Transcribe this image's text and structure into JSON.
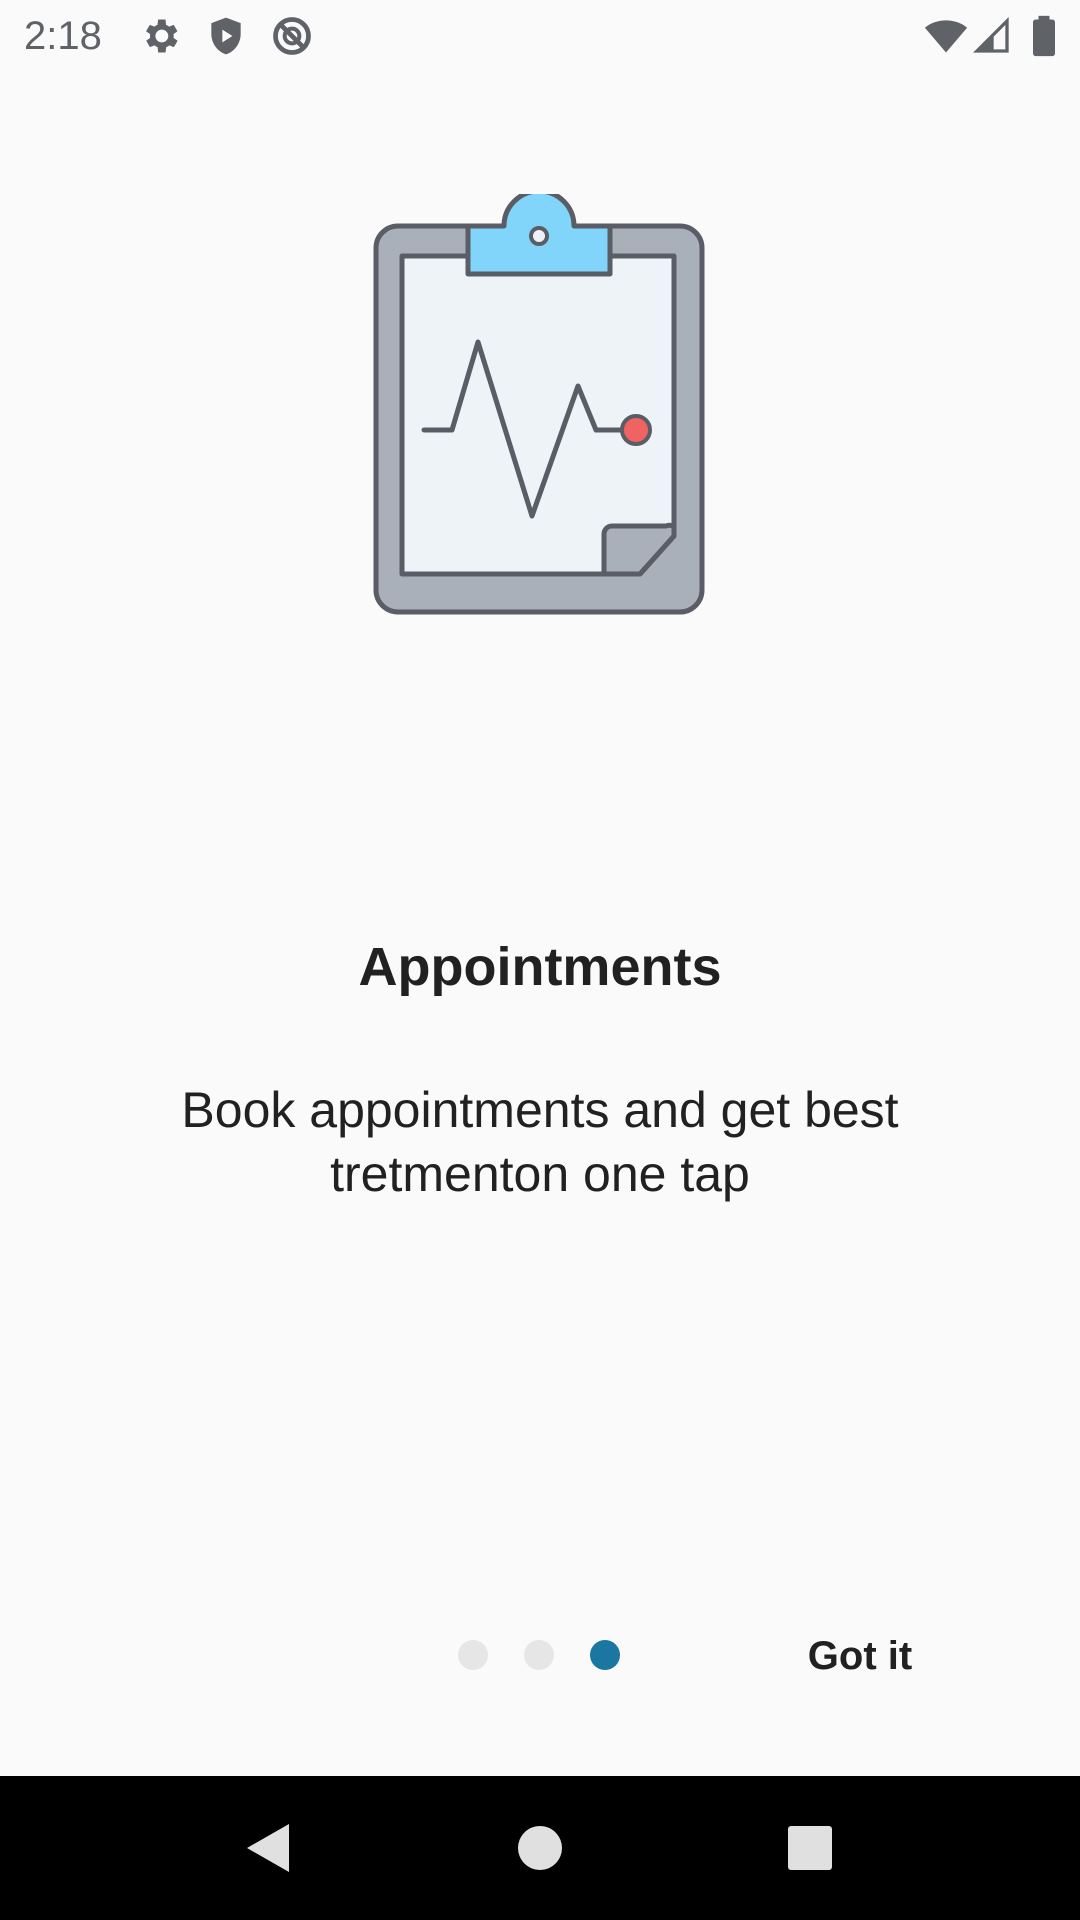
{
  "status_bar": {
    "time": "2:18",
    "left_icons": [
      "gear-icon",
      "shield-play-icon",
      "do-not-disturb-icon"
    ],
    "right_icons": [
      "wifi-icon",
      "cell-signal-icon",
      "battery-icon"
    ]
  },
  "onboarding": {
    "illustration_icon": "clipboard-heartbeat-icon",
    "title": "Appointments",
    "description": "Book appointments and get best tretmenton one tap",
    "page_indicator": {
      "total": 3,
      "active_index": 2
    },
    "got_it_label": "Got it"
  },
  "nav_bar": {
    "buttons": [
      "back-icon",
      "home-icon",
      "recents-icon"
    ]
  },
  "colors": {
    "background": "#fafafa",
    "accent": "#1c76a2",
    "inactive_dot": "#e6e6e6",
    "clip_blue": "#81d4fa",
    "pulse_dot": "#f06363",
    "text": "#212121"
  }
}
